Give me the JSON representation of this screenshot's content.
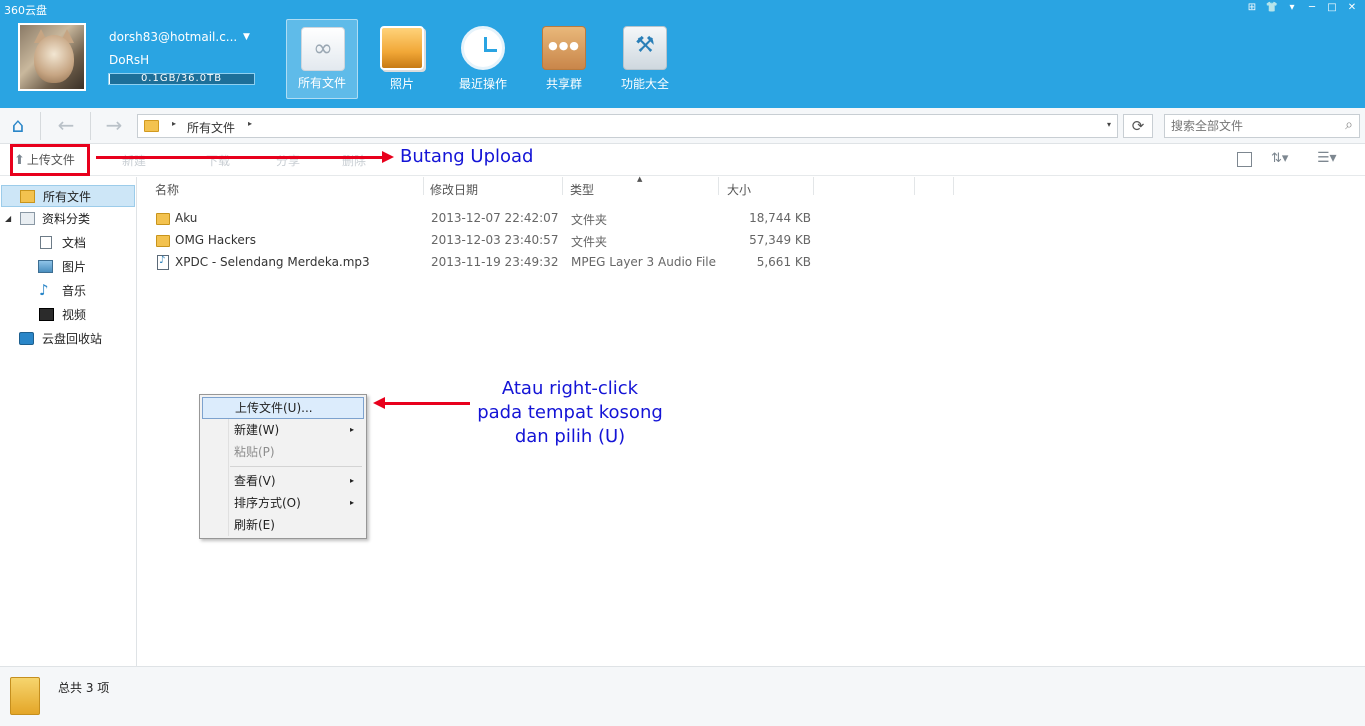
{
  "app": {
    "title": "360云盘"
  },
  "window_controls": [
    "⊞",
    "👕",
    "▾",
    "─",
    "□",
    "✕"
  ],
  "user": {
    "email": "dorsh83@hotmail.c...",
    "name": "DoRsH",
    "quota_text": "0.1GB/36.0TB",
    "quota_fraction": 0.01
  },
  "nav": [
    {
      "label": "所有文件",
      "icon": "cloud-files-icon",
      "active": true
    },
    {
      "label": "照片",
      "icon": "photos-icon",
      "active": false
    },
    {
      "label": "最近操作",
      "icon": "clock-icon",
      "active": false
    },
    {
      "label": "共享群",
      "icon": "share-group-icon",
      "active": false
    },
    {
      "label": "功能大全",
      "icon": "tools-icon",
      "active": false
    }
  ],
  "address": {
    "home_glyph": "⌂",
    "back_glyph": "←",
    "forward_glyph": "→",
    "path": "所有文件",
    "arrow_glyph": "▸",
    "dropdown_glyph": "▾",
    "refresh_glyph": "⟳",
    "search_placeholder": "搜索全部文件",
    "search_glyph": "⌕"
  },
  "toolbar": {
    "upload_glyph": "⬆",
    "upload_label": "上传文件",
    "faded": [
      "新建",
      "下载",
      "分享",
      "删除"
    ],
    "sort_glyph": "⇅▾",
    "list_glyph": "☰▾"
  },
  "annotation_upload": {
    "text": "Butang Upload",
    "color": "#1414d6"
  },
  "sidebar": {
    "all_files": "所有文件",
    "category": "资料分类",
    "expand_glyph": "◢",
    "items": [
      {
        "label": "文档",
        "icon": "document-icon"
      },
      {
        "label": "图片",
        "icon": "image-icon"
      },
      {
        "label": "音乐",
        "icon": "music-icon"
      },
      {
        "label": "视频",
        "icon": "video-icon"
      }
    ],
    "recycle": "云盘回收站"
  },
  "columns": {
    "name": "名称",
    "modified": "修改日期",
    "type": "类型",
    "size": "大小",
    "sort_glyph": "▲"
  },
  "files": [
    {
      "name": "Aku",
      "modified": "2013-12-07 22:42:07",
      "type": "文件夹",
      "size": "18,744 KB",
      "icon": "folder-icon"
    },
    {
      "name": "OMG Hackers",
      "modified": "2013-12-03 23:40:57",
      "type": "文件夹",
      "size": "57,349 KB",
      "icon": "folder-icon"
    },
    {
      "name": "XPDC - Selendang Merdeka.mp3",
      "modified": "2013-11-19 23:49:32",
      "type": "MPEG Layer 3 Audio File",
      "size": "5,661 KB",
      "icon": "audio-file-icon"
    }
  ],
  "context_menu": {
    "submenu_glyph": "▸",
    "items": [
      {
        "label": "上传文件(U)...",
        "highlighted": true,
        "disabled": false,
        "submenu": false
      },
      {
        "label": "新建(W)",
        "highlighted": false,
        "disabled": false,
        "submenu": true
      },
      {
        "label": "粘贴(P)",
        "highlighted": false,
        "disabled": true,
        "submenu": false
      },
      {
        "label": "查看(V)",
        "highlighted": false,
        "disabled": false,
        "submenu": true
      },
      {
        "label": "排序方式(O)",
        "highlighted": false,
        "disabled": false,
        "submenu": true
      },
      {
        "label": "刷新(E)",
        "highlighted": false,
        "disabled": false,
        "submenu": false
      }
    ]
  },
  "annotation_rightclick": {
    "lines": [
      "Atau right-click",
      "pada tempat kosong",
      "dan pilih (U)"
    ],
    "color": "#1414d6"
  },
  "status": {
    "text": "总共 3 项"
  },
  "colors": {
    "header_bg": "#2aa4e2",
    "annotation_red": "#e8001c",
    "selection": "#cde6f7"
  }
}
